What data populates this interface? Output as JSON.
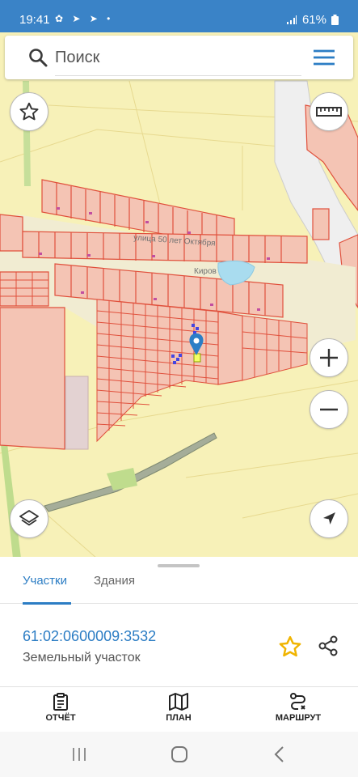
{
  "status_bar": {
    "time": "19:41",
    "battery": "61%"
  },
  "search": {
    "placeholder": "Поиск"
  },
  "map": {
    "labels": {
      "street": "улица 50 лет Октября",
      "village": "Киров"
    },
    "colors": {
      "background": "#f7f1b8",
      "parcel_fill": "#f4c4b4",
      "parcel_stroke": "#e0503c",
      "water": "#a9dcef",
      "pin": "#2b7ec6"
    }
  },
  "tabs": [
    {
      "label": "Участки",
      "active": true
    },
    {
      "label": "Здания",
      "active": false
    }
  ],
  "parcel": {
    "cadastral_number": "61:02:0600009:3532",
    "type": "Земельный участок"
  },
  "bottom_nav": [
    {
      "label": "ОТЧЁТ",
      "icon": "report-icon"
    },
    {
      "label": "ПЛАН",
      "icon": "map-plan-icon"
    },
    {
      "label": "МАРШРУТ",
      "icon": "route-icon"
    }
  ],
  "colors": {
    "accent": "#2c7dc4",
    "status_bar": "#3a83c7",
    "favorite": "#f0b400"
  }
}
